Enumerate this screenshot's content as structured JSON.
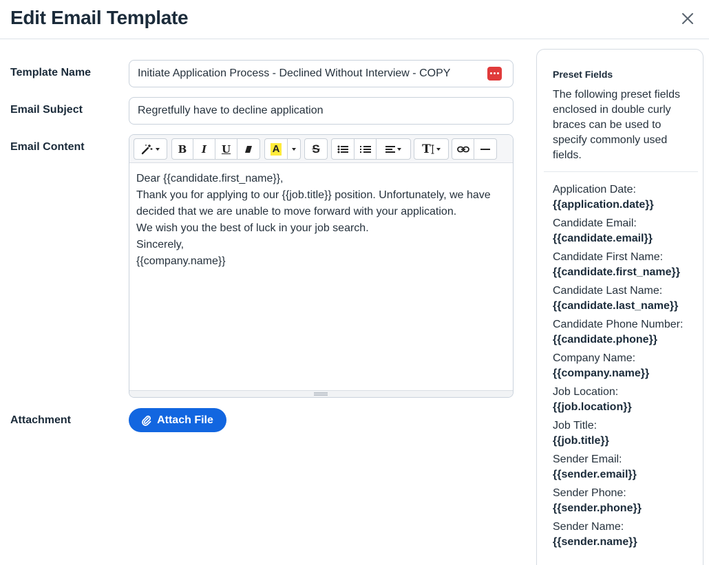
{
  "dialog": {
    "title": "Edit Email Template"
  },
  "form": {
    "template_name_label": "Template Name",
    "template_name_value": "Initiate Application Process - Declined Without Interview - COPY",
    "email_subject_label": "Email Subject",
    "email_subject_value": "Regretfully have to decline application",
    "email_content_label": "Email Content",
    "attachment_label": "Attachment",
    "attach_button_label": "Attach File"
  },
  "editor": {
    "lines": [
      "Dear {{candidate.first_name}},",
      "Thank you for applying to our {{job.title}} position. Unfortunately, we have decided that we are unable to move forward with your application.",
      "We wish you the best of luck in your job search.",
      "Sincerely,",
      "{{company.name}}"
    ],
    "toolbar": {
      "bold": "B",
      "italic": "I",
      "underline": "U",
      "highlight": "A",
      "strikethrough": "S",
      "font_size": "T"
    }
  },
  "preset": {
    "title": "Preset Fields",
    "description": "The following preset fields enclosed in double curly braces can be used to specify commonly used fields.",
    "fields": [
      {
        "label": "Application Date:",
        "code": "{{application.date}}"
      },
      {
        "label": "Candidate Email:",
        "code": "{{candidate.email}}"
      },
      {
        "label": "Candidate First Name:",
        "code": "{{candidate.first_name}}"
      },
      {
        "label": "Candidate Last Name:",
        "code": "{{candidate.last_name}}"
      },
      {
        "label": "Candidate Phone Number:",
        "code": "{{candidate.phone}}"
      },
      {
        "label": "Company Name:",
        "code": "{{company.name}}"
      },
      {
        "label": "Job Location:",
        "code": "{{job.location}}"
      },
      {
        "label": "Job Title:",
        "code": "{{job.title}}"
      },
      {
        "label": "Sender Email:",
        "code": "{{sender.email}}"
      },
      {
        "label": "Sender Phone:",
        "code": "{{sender.phone}}"
      },
      {
        "label": "Sender Name:",
        "code": "{{sender.name}}"
      }
    ]
  },
  "colors": {
    "accent": "#1266e0",
    "password_manager_icon": "#e03b3b",
    "highlight_swatch": "#ffeb3b"
  }
}
